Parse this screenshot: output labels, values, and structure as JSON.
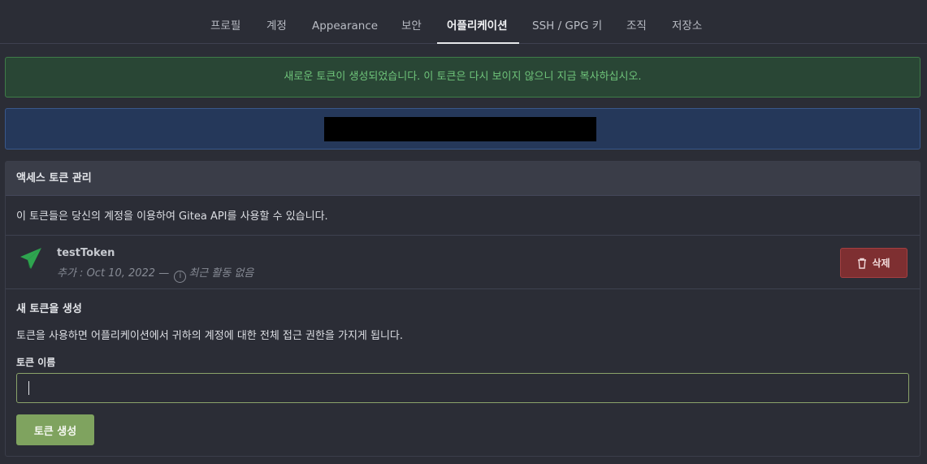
{
  "tabs": [
    {
      "label": "프로필"
    },
    {
      "label": "계정"
    },
    {
      "label": "Appearance"
    },
    {
      "label": "보안"
    },
    {
      "label": "어플리케이션",
      "active": true
    },
    {
      "label": "SSH / GPG 키"
    },
    {
      "label": "조직"
    },
    {
      "label": "저장소"
    }
  ],
  "success_message": "새로운 토큰이 생성되었습니다. 이 토큰은 다시 보이지 않으니 지금 복사하십시오.",
  "access_tokens": {
    "header": "액세스 토큰 관리",
    "description": "이 토큰들은 당신의 계정을 이용하여 Gitea API를 사용할 수 있습니다.",
    "tokens": [
      {
        "name": "testToken",
        "added_prefix": "추가 : Oct 10, 2022 —",
        "last_used": "최근 활동 없음",
        "delete_label": "삭제"
      }
    ]
  },
  "new_token": {
    "title": "새 토큰을 생성",
    "description": "토큰을 사용하면 어플리케이션에서 귀하의 계정에 대한 전체 접근 권한을 가지게 됩니다.",
    "name_label": "토큰 이름",
    "name_value": "",
    "generate_label": "토큰 생성"
  },
  "colors": {
    "accent_green": "#7fa35f",
    "success_text": "#6fc47a",
    "danger": "#7e2f31",
    "token_icon": "#2ea44f"
  },
  "icons": {
    "token": "paper-plane-icon",
    "delete": "trash-icon",
    "info": "info-icon"
  }
}
